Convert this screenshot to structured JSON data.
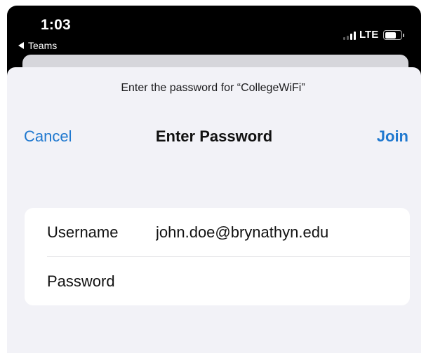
{
  "status_bar": {
    "time": "1:03",
    "back_app": "Teams",
    "network": "LTE",
    "signal_bars_active": 2,
    "signal_bars_total": 4
  },
  "dialog": {
    "prompt": "Enter the password for “CollegeWiFi”",
    "title": "Enter Password",
    "cancel_label": "Cancel",
    "join_label": "Join"
  },
  "fields": {
    "username": {
      "label": "Username",
      "value": "john.doe@brynathyn.edu"
    },
    "password": {
      "label": "Password",
      "value": ""
    }
  },
  "colors": {
    "accent": "#1f78cf",
    "sheet_background": "#f2f2f7",
    "status_bar_background": "#000000"
  }
}
